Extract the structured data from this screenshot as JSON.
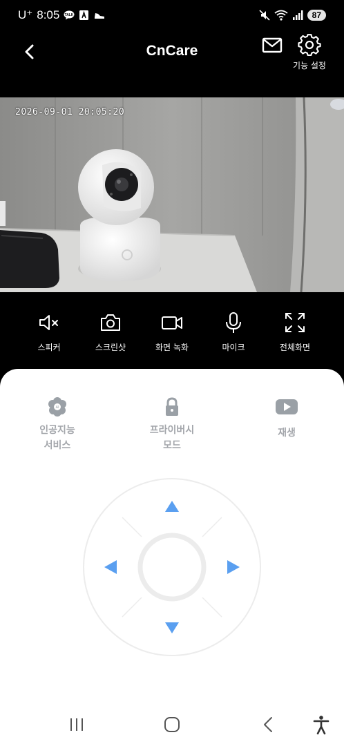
{
  "status": {
    "carrier": "U⁺",
    "time": "8:05",
    "battery": "87",
    "left_icons": [
      "talk-icon",
      "a-icon",
      "shoe-icon"
    ],
    "right_icons": [
      "mute-icon",
      "wifi-icon",
      "signal-icon"
    ]
  },
  "header": {
    "title": "CnCare",
    "settings_label": "기능 설정"
  },
  "video": {
    "timestamp": "2026-09-01 20:05:20"
  },
  "controls": [
    {
      "label": "스피커",
      "icon": "speaker-muted-icon"
    },
    {
      "label": "스크린샷",
      "icon": "camera-icon"
    },
    {
      "label": "화면 녹화",
      "icon": "video-record-icon"
    },
    {
      "label": "마이크",
      "icon": "microphone-icon"
    },
    {
      "label": "전체화면",
      "icon": "fullscreen-icon"
    }
  ],
  "features": {
    "ai": {
      "line1": "인공지능",
      "line2": "서비스",
      "icon": "ai-flower-icon"
    },
    "privacy": {
      "line1": "프라이버시",
      "line2": "모드",
      "icon": "lock-icon"
    },
    "playback": {
      "label": "재생",
      "icon": "play-icon"
    }
  },
  "colors": {
    "accent": "#5a9ff0",
    "muted_text": "#a3a6ab",
    "background": "#000000",
    "panel": "#ffffff"
  }
}
